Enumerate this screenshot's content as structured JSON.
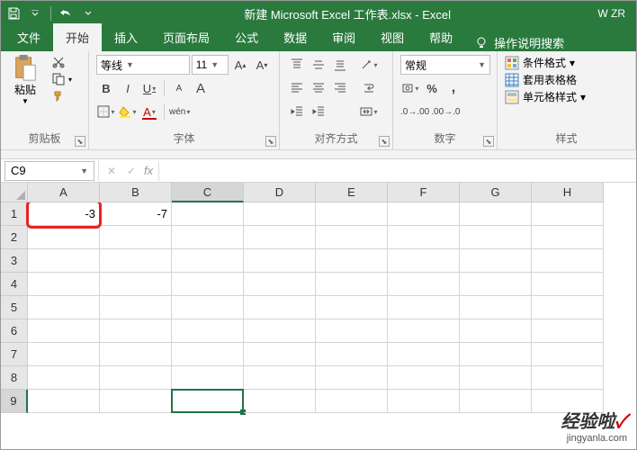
{
  "title": "新建 Microsoft Excel 工作表.xlsx  -  Excel",
  "user": "W ZR",
  "tabs": [
    "文件",
    "开始",
    "插入",
    "页面布局",
    "公式",
    "数据",
    "审阅",
    "视图",
    "帮助"
  ],
  "active_tab_index": 1,
  "tell_me": "操作说明搜索",
  "clipboard": {
    "paste": "粘贴",
    "label": "剪贴板"
  },
  "font": {
    "name": "等线",
    "size": "11",
    "label": "字体",
    "bold": "B",
    "italic": "I",
    "underline": "U",
    "phonetic": "wén"
  },
  "alignment": {
    "label": "对齐方式"
  },
  "number": {
    "format": "常规",
    "label": "数字"
  },
  "styles": {
    "cond": "条件格式",
    "table": "套用表格格",
    "cell": "单元格样式",
    "label": "样式"
  },
  "cell_ref": "C9",
  "columns": [
    "A",
    "B",
    "C",
    "D",
    "E",
    "F",
    "G",
    "H"
  ],
  "rows": [
    "1",
    "2",
    "3",
    "4",
    "5",
    "6",
    "7",
    "8",
    "9"
  ],
  "selected": {
    "row": 9,
    "col": "C"
  },
  "data": {
    "A1": "-3",
    "B1": "-7"
  },
  "watermark": {
    "brand": "经验啦",
    "url": "jingyanla.com"
  }
}
